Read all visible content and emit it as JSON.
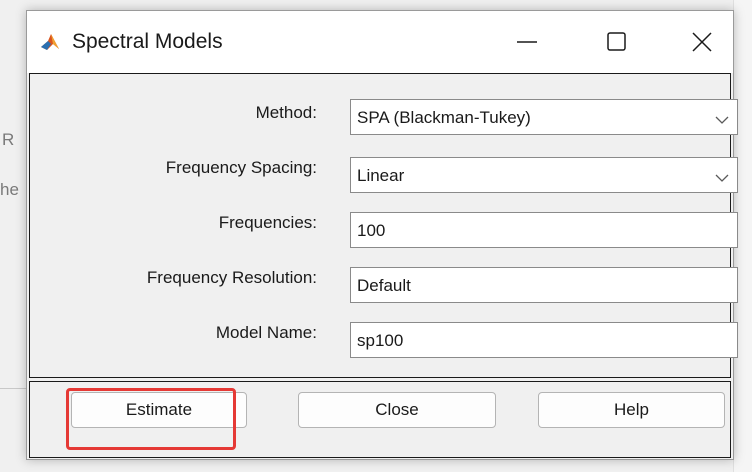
{
  "background": {
    "fragment_1": "R",
    "fragment_2": "he"
  },
  "window": {
    "title": "Spectral Models",
    "app_icon": "matlab-icon"
  },
  "form": {
    "method": {
      "label": "Method:",
      "value": "SPA (Blackman-Tukey)"
    },
    "frequency_spacing": {
      "label": "Frequency Spacing:",
      "value": "Linear"
    },
    "frequencies": {
      "label": "Frequencies:",
      "value": "100"
    },
    "frequency_resolution": {
      "label": "Frequency Resolution:",
      "value": "Default"
    },
    "model_name": {
      "label": "Model Name:",
      "value": "sp100"
    }
  },
  "buttons": {
    "estimate": "Estimate",
    "close": "Close",
    "help": "Help"
  },
  "highlight_color": "#e53935"
}
